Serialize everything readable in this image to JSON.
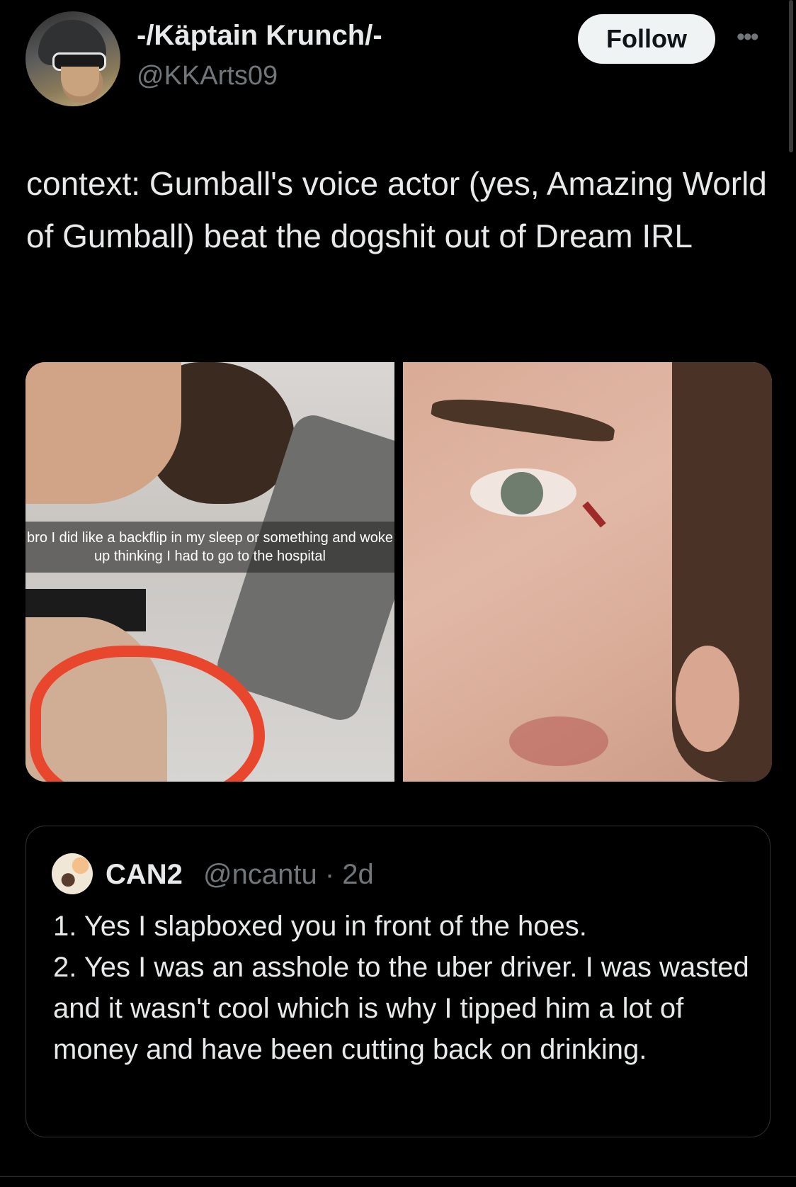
{
  "author": {
    "display_name": "-/Käptain Krunch/-",
    "handle": "@KKArts09",
    "follow_label": "Follow"
  },
  "tweet": {
    "text": "context: Gumball's voice actor (yes, Amazing World of Gumball) beat the dogshit out of Dream IRL"
  },
  "media": {
    "left_caption": "bro I did like a backflip in my sleep or something and woke up thinking I had to go to the hospital"
  },
  "quoted_tweet": {
    "display_name": "CAN2",
    "meta": "@ncantu · 2d",
    "lines": [
      "1. Yes I slapboxed you in front of the hoes.",
      "2. Yes I was an asshole to the uber driver. I was wasted and it wasn't cool which is why I tipped him a lot of money and have been cutting back on drinking."
    ]
  },
  "icons": {
    "more": "more-horizontal-icon"
  },
  "colors": {
    "background": "#000000",
    "text_primary": "#e7e9ea",
    "text_secondary": "#71767b",
    "follow_bg": "#eff3f4",
    "border": "#2f3336"
  }
}
